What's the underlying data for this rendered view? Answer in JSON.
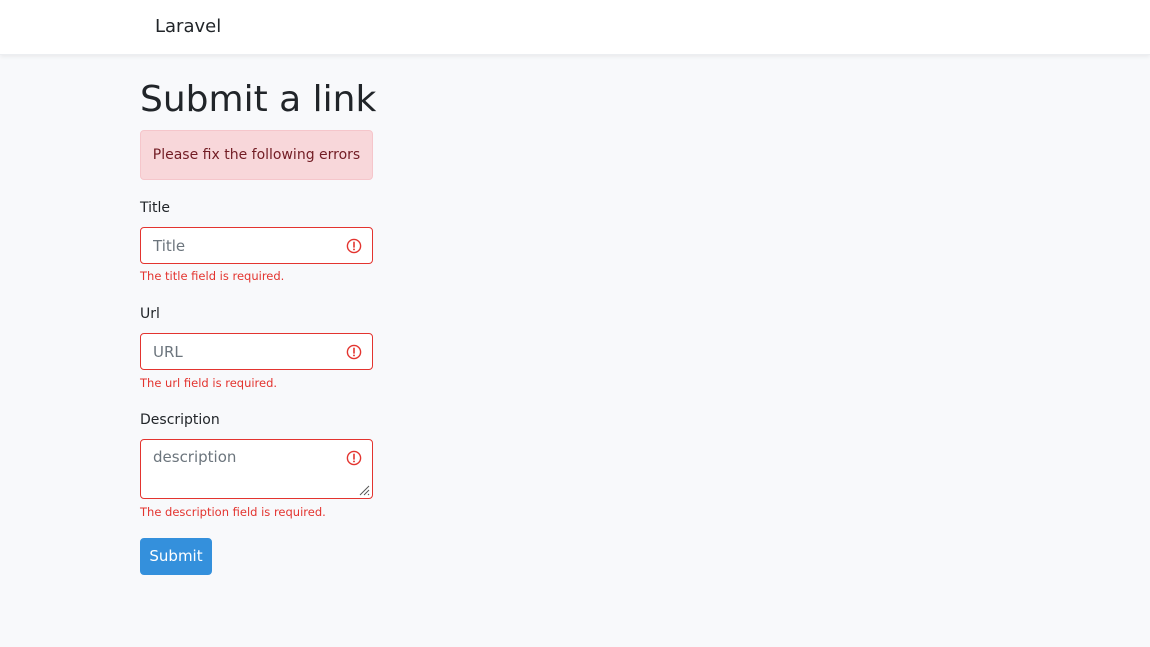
{
  "navbar": {
    "brand": "Laravel"
  },
  "page": {
    "title": "Submit a link",
    "alert": "Please fix the following errors"
  },
  "form": {
    "title": {
      "label": "Title",
      "placeholder": "Title",
      "value": "",
      "error": "The title field is required."
    },
    "url": {
      "label": "Url",
      "placeholder": "URL",
      "value": "",
      "error": "The url field is required."
    },
    "description": {
      "label": "Description",
      "placeholder": "description",
      "value": "",
      "error": "The description field is required."
    },
    "submit_label": "Submit"
  },
  "colors": {
    "error": "#e3342f",
    "primary": "#3490dc",
    "alert_bg": "#f8d7da",
    "alert_text": "#721c24",
    "page_bg": "#f8f9fb"
  },
  "icons": {
    "field_error": "exclamation-circle-icon",
    "textarea_resize": "resize-grip-icon"
  }
}
